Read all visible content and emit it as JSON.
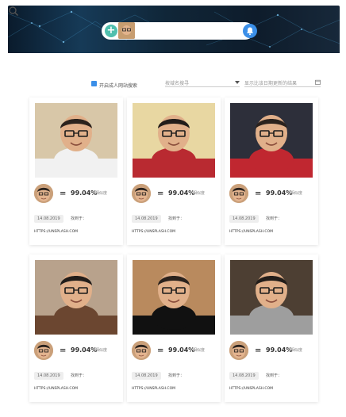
{
  "toolbar": {
    "add_label": "+"
  },
  "filters": {
    "adult_toggle": "开启成人网站搜索",
    "site_select": "按域名搜寻",
    "date_placeholder": "显示比该日期更新的结果"
  },
  "cards": [
    {
      "similarity": "99.04%",
      "sim_label": "相似度",
      "date": "14.08.2019",
      "found_label": "找到于：",
      "source": "HTTPS://UNSPLASH.COM",
      "bg": "#d8c7a8"
    },
    {
      "similarity": "99.04%",
      "sim_label": "相似度",
      "date": "14.08.2019",
      "found_label": "找到于：",
      "source": "HTTPS://UNSPLASH.COM",
      "bg": "#e8d7a2"
    },
    {
      "similarity": "99.04%",
      "sim_label": "相似度",
      "date": "14.08.2019",
      "found_label": "找到于：",
      "source": "HTTPS://UNSPLASH.COM",
      "bg": "#2d2f3a"
    },
    {
      "similarity": "99.04%",
      "sim_label": "相似度",
      "date": "14.08.2019",
      "found_label": "找到于：",
      "source": "HTTPS://UNSPLASH.COM",
      "bg": "#b8a28c"
    },
    {
      "similarity": "99.04%",
      "sim_label": "相似度",
      "date": "14.08.2019",
      "found_label": "找到于：",
      "source": "HTTPS://UNSPLASH.COM",
      "bg": "#b98a5e"
    },
    {
      "similarity": "99.04%",
      "sim_label": "相似度",
      "date": "14.08.2019",
      "found_label": "找到于：",
      "source": "HTTPS://UNSPLASH.COM",
      "bg": "#4d3f33"
    }
  ],
  "colors": {
    "accent": "#3b8fe8",
    "add_button": "#4fbfae",
    "header_bg": "#0f2235"
  }
}
